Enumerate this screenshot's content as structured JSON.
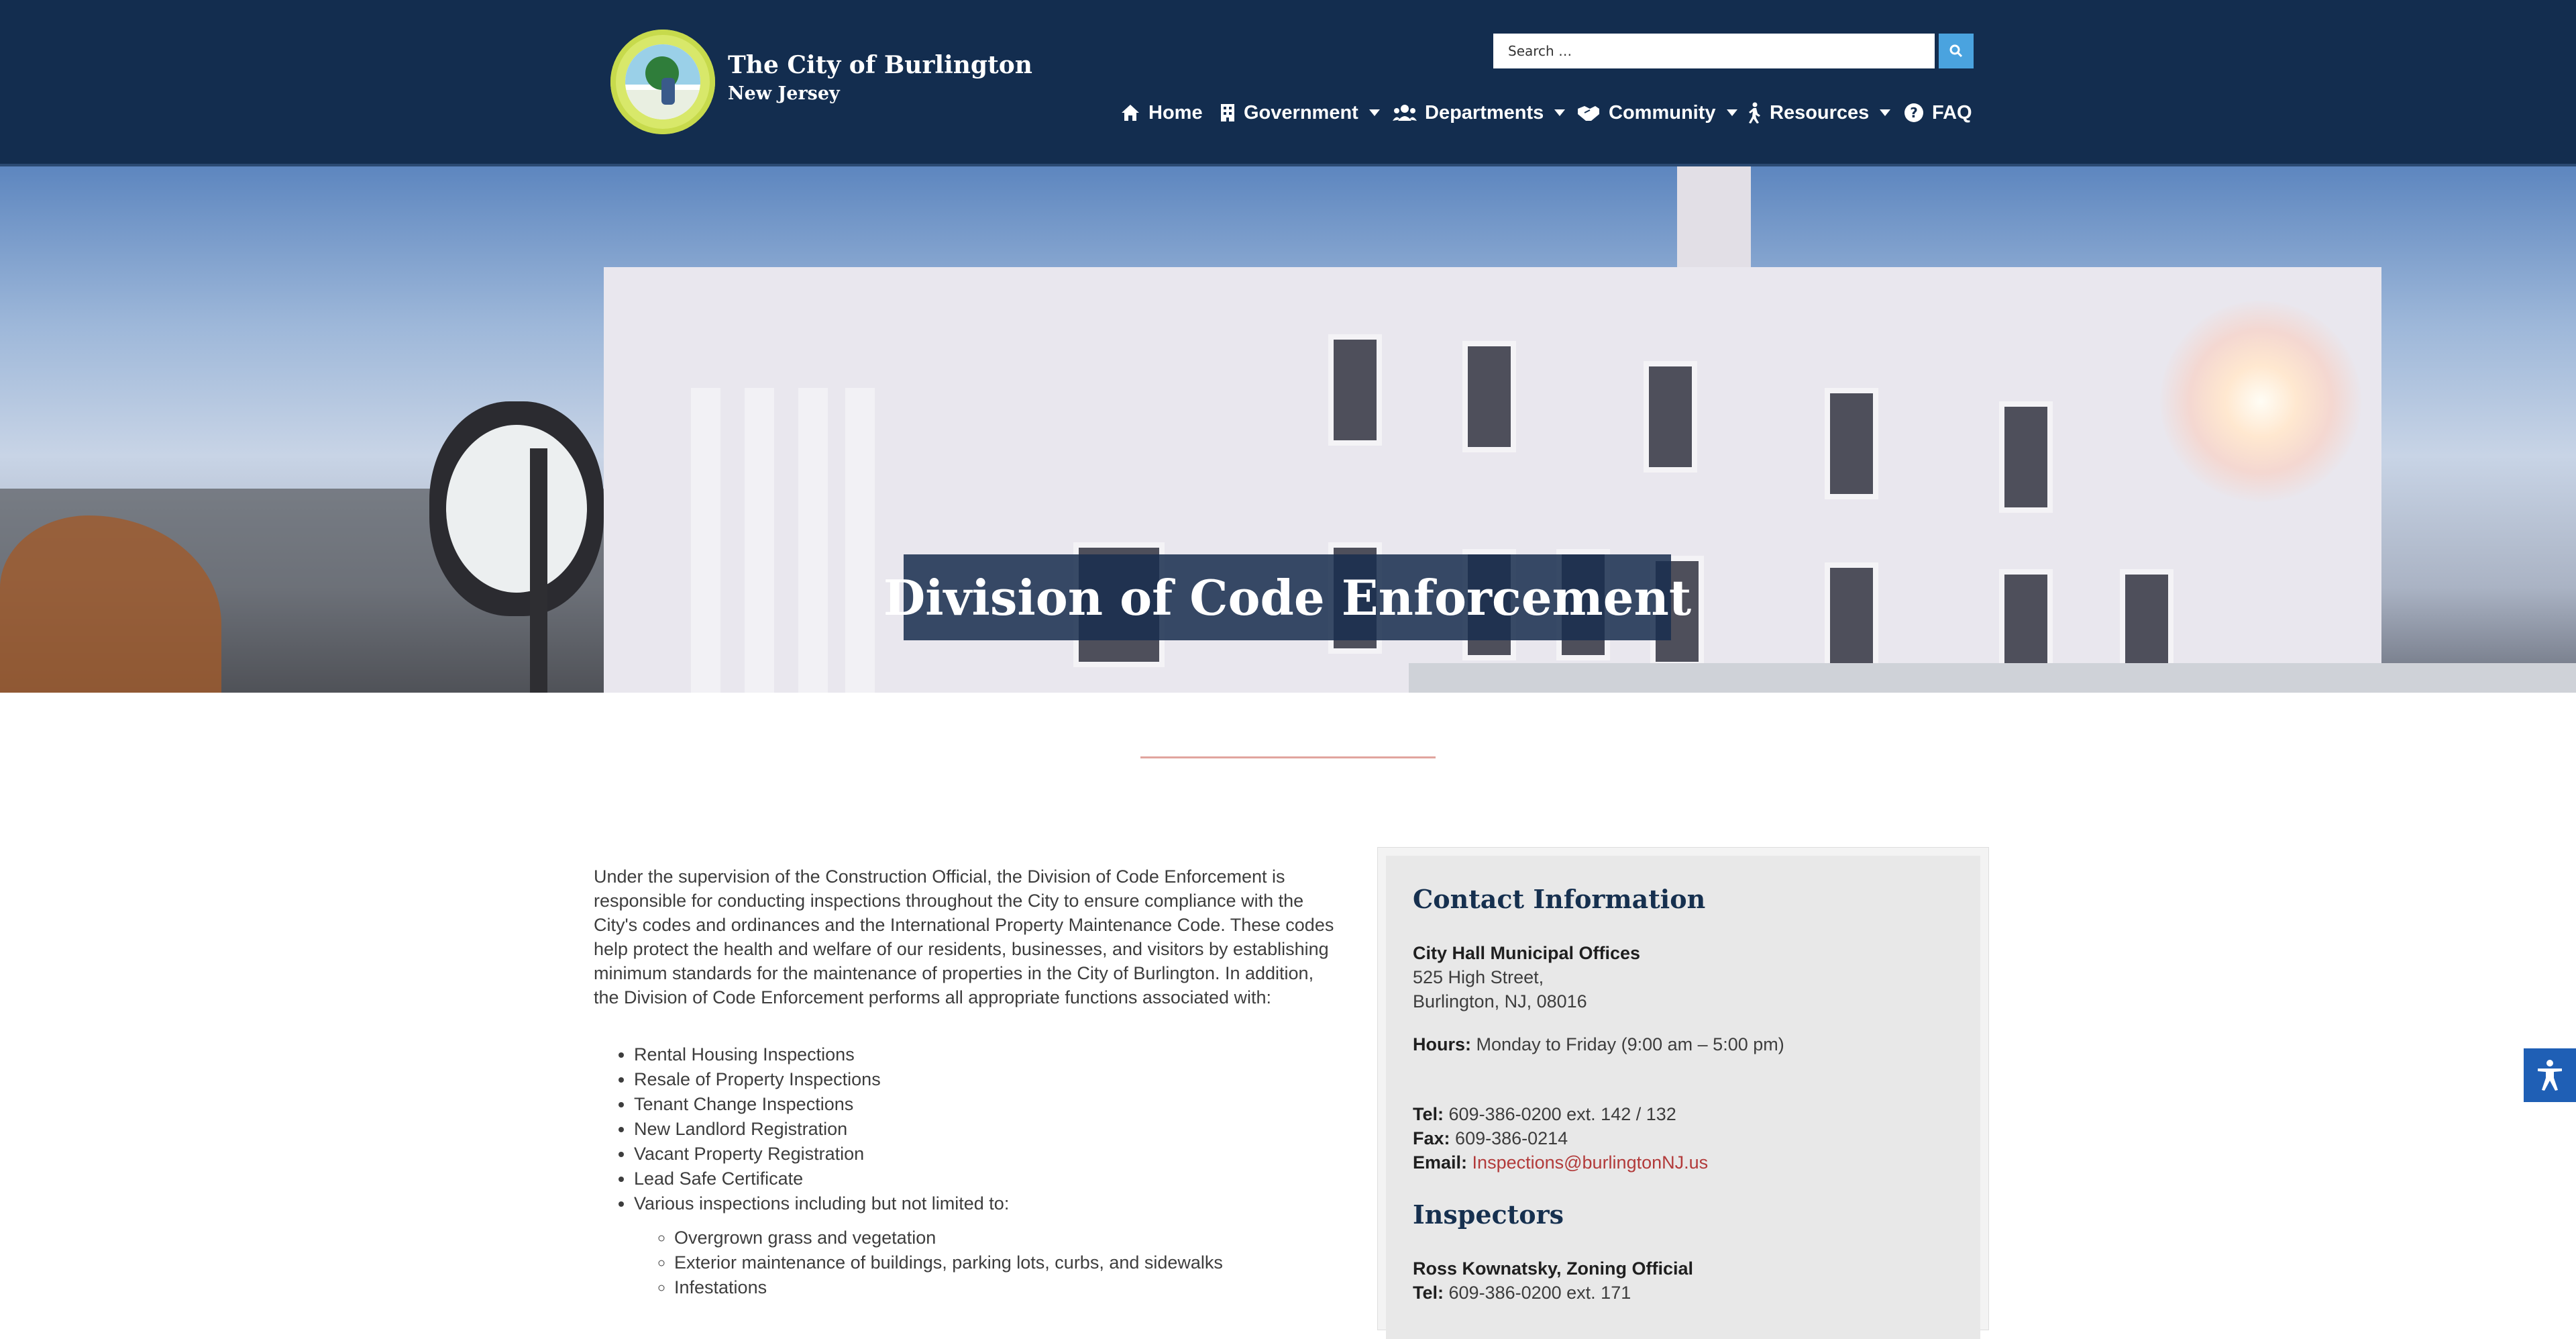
{
  "header": {
    "site_title": "The City of Burlington",
    "site_subtitle": "New Jersey",
    "search_placeholder": "Search …",
    "nav": [
      {
        "label": "Home",
        "icon": "home-icon",
        "has_dropdown": false
      },
      {
        "label": "Government",
        "icon": "building-icon",
        "has_dropdown": true
      },
      {
        "label": "Departments",
        "icon": "users-icon",
        "has_dropdown": true
      },
      {
        "label": "Community",
        "icon": "handshake-icon",
        "has_dropdown": true
      },
      {
        "label": "Resources",
        "icon": "walking-icon",
        "has_dropdown": true
      },
      {
        "label": "FAQ",
        "icon": "question-circle-icon",
        "has_dropdown": false
      }
    ]
  },
  "hero": {
    "title": "Division of Code Enforcement"
  },
  "content": {
    "intro": "Under the supervision of the Construction Official, the Division of Code Enforcement is responsible for conducting inspections throughout the City to ensure compliance with the City's codes and ordinances and the International Property Maintenance Code. These codes help protect the health and welfare of our residents, businesses, and visitors by establishing minimum standards for the maintenance of properties in the City of Burlington. In addition, the Division of Code Enforcement performs all appropriate functions associated with:",
    "functions": [
      "Rental Housing Inspections",
      "Resale of Property Inspections",
      "Tenant Change Inspections",
      "New Landlord Registration",
      "Vacant Property Registration",
      "Lead Safe Certificate",
      "Various inspections including but not limited to:"
    ],
    "sub_functions": [
      "Overgrown grass and vegetation",
      "Exterior maintenance of buildings, parking lots, curbs, and sidewalks",
      "Infestations"
    ]
  },
  "sidebar": {
    "contact_heading": "Contact Information",
    "office_name": "City Hall Municipal Offices",
    "address_line1": "525 High Street,",
    "address_line2": "Burlington, NJ, 08016",
    "hours_label": "Hours:",
    "hours_value": "Monday to Friday (9:00 am – 5:00 pm)",
    "tel_label": "Tel:",
    "tel_value": "609-386-0200 ext. 142 / 132",
    "fax_label": "Fax:",
    "fax_value": "609-386-0214",
    "email_label": "Email:",
    "email_value": "Inspections@burlingtonNJ.us",
    "inspectors_heading": "Inspectors",
    "inspector1_name": "Ross Kownatsky, Zoning Official",
    "inspector1_tel_label": "Tel:",
    "inspector1_tel_value": "609-386-0200 ext. 171"
  },
  "colors": {
    "header_bg": "#132d4f",
    "search_button": "#4aa3df",
    "link": "#b23a3a",
    "accessibility_button": "#1f5fb5"
  }
}
